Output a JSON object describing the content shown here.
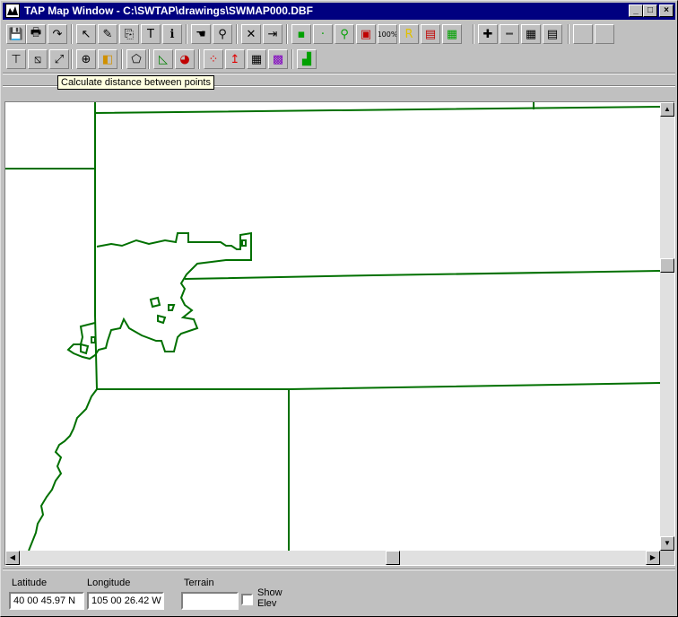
{
  "window": {
    "title": "TAP Map Window - C:\\SWTAP\\drawings\\SWMAP000.DBF",
    "controls": {
      "minimize": "_",
      "maximize": "□",
      "close": "×"
    }
  },
  "toolbar1": [
    {
      "name": "save-button",
      "icon": "save-icon",
      "glyph": "💾"
    },
    {
      "name": "print-button",
      "icon": "print-icon",
      "glyph": "🖶"
    },
    {
      "name": "redo-button",
      "icon": "redo-arrow-icon",
      "glyph": "↷"
    },
    {
      "name": "select-button",
      "icon": "pointer-arrow-icon",
      "glyph": "↖"
    },
    {
      "name": "draw-button",
      "icon": "draw-pen-icon",
      "glyph": "✎"
    },
    {
      "name": "edit-button",
      "icon": "edit-icon",
      "glyph": "⎘"
    },
    {
      "name": "text-button",
      "icon": "text-icon",
      "glyph": "T"
    },
    {
      "name": "info-button",
      "icon": "info-icon",
      "glyph": "ℹ"
    },
    {
      "name": "pan-button",
      "icon": "hand-pan-icon",
      "glyph": "☚"
    },
    {
      "name": "search-button",
      "icon": "search-icon",
      "glyph": "⚲"
    },
    {
      "name": "delete-button",
      "icon": "delete-x-icon",
      "glyph": "✕"
    },
    {
      "name": "exit-button",
      "icon": "exit-door-icon",
      "glyph": "⇥"
    },
    {
      "name": "zoom-in-button",
      "icon": "zoom-in-icon",
      "glyph": "▪"
    },
    {
      "name": "zoom-out-button",
      "icon": "zoom-out-icon",
      "glyph": "·"
    },
    {
      "name": "magnify-button",
      "icon": "magnify-icon",
      "glyph": "⚲"
    },
    {
      "name": "zoom-extent-button",
      "icon": "zoom-extent-icon",
      "glyph": "▣"
    },
    {
      "name": "zoom-100-button",
      "icon": "zoom-100-icon",
      "glyph": "100%"
    },
    {
      "name": "redraw-button",
      "icon": "redraw-r-icon",
      "glyph": "R"
    },
    {
      "name": "layer-button",
      "icon": "layer-icon",
      "glyph": "▤"
    },
    {
      "name": "grid-button",
      "icon": "grid-small-icon",
      "glyph": "▦"
    },
    {
      "name": "add-button",
      "icon": "plus-icon",
      "glyph": "✚"
    },
    {
      "name": "scale-button",
      "icon": "ruler-icon",
      "glyph": "┉"
    },
    {
      "name": "table-button",
      "icon": "table-icon",
      "glyph": "▦"
    },
    {
      "name": "notes-button",
      "icon": "notepad-icon",
      "glyph": "▤"
    },
    {
      "name": "blank-button-1",
      "icon": "blank-icon",
      "glyph": ""
    },
    {
      "name": "blank-button-2",
      "icon": "blank-icon",
      "glyph": ""
    }
  ],
  "toolbar2": [
    {
      "name": "line-tool-button",
      "icon": "line-tool-icon",
      "glyph": "⊤"
    },
    {
      "name": "node-tool-button",
      "icon": "node-tool-icon",
      "glyph": "⧅"
    },
    {
      "name": "distance-tool-button",
      "icon": "distance-arrow-icon",
      "glyph": "⤢"
    },
    {
      "name": "crosshair-button",
      "icon": "crosshair-icon",
      "glyph": "⊕"
    },
    {
      "name": "overlay-button",
      "icon": "overlay-icon",
      "glyph": "◧"
    },
    {
      "name": "polygon-button",
      "icon": "polygon-icon",
      "glyph": "⬠"
    },
    {
      "name": "area-button",
      "icon": "area-icon",
      "glyph": "◺"
    },
    {
      "name": "coverage-button",
      "icon": "coverage-icon",
      "glyph": "◕"
    },
    {
      "name": "points-button",
      "icon": "points-icon",
      "glyph": "⁘"
    },
    {
      "name": "vectors-button",
      "icon": "vector-arrow-icon",
      "glyph": "↥"
    },
    {
      "name": "grid-map-button",
      "icon": "grid-map-icon",
      "glyph": "▦"
    },
    {
      "name": "color-grid-button",
      "icon": "color-grid-icon",
      "glyph": "▩"
    },
    {
      "name": "profile-button",
      "icon": "profile-chart-icon",
      "glyph": "▟"
    }
  ],
  "tooltip": "Calculate distance between points",
  "status": {
    "latitude_label": "Latitude",
    "latitude_value": "40 00 45.97 N",
    "longitude_label": "Longitude",
    "longitude_value": "105 00 26.42 W",
    "terrain_label": "Terrain",
    "terrain_value": "",
    "show_elev_line1": "Show",
    "show_elev_line2": "Elev"
  },
  "colors": {
    "map_lines": "#007000",
    "titlebar": "#000080",
    "face": "#c0c0c0"
  }
}
